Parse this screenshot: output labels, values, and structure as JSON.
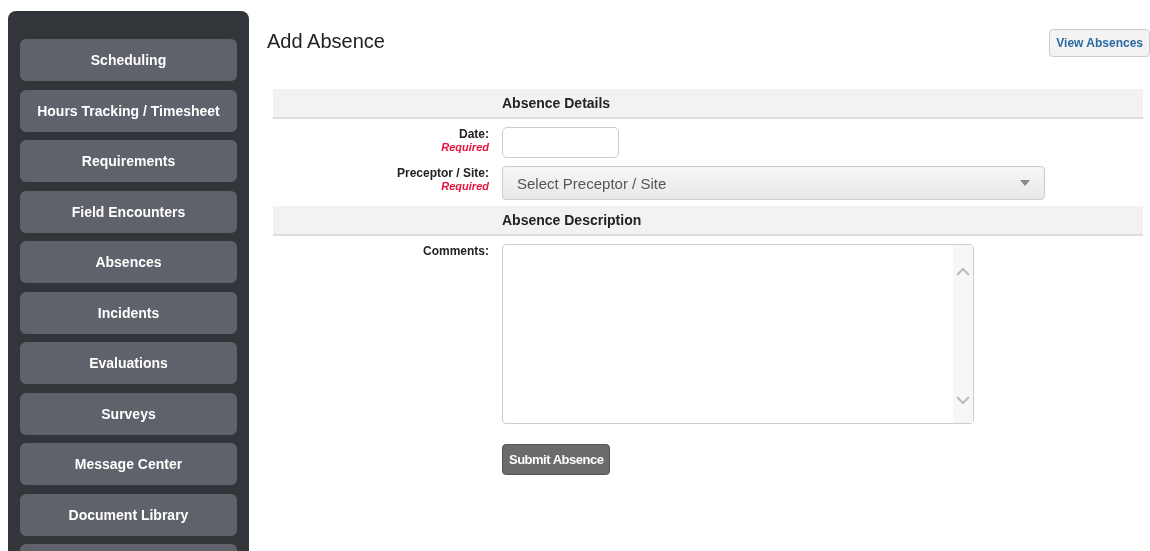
{
  "sidebar": {
    "items": [
      {
        "label": "Scheduling"
      },
      {
        "label": "Hours Tracking / Timesheet"
      },
      {
        "label": "Requirements"
      },
      {
        "label": "Field Encounters"
      },
      {
        "label": "Absences"
      },
      {
        "label": "Incidents"
      },
      {
        "label": "Evaluations"
      },
      {
        "label": "Surveys"
      },
      {
        "label": "Message Center"
      },
      {
        "label": "Document Library"
      }
    ]
  },
  "page": {
    "title": "Add Absence",
    "view_button": "View Absences"
  },
  "sections": [
    {
      "title": "Absence Details",
      "fields": [
        {
          "kind": "text",
          "label": "Date:",
          "required_note": "Required"
        },
        {
          "kind": "select",
          "label": "Preceptor / Site:",
          "required_note": "Required",
          "placeholder": "Select Preceptor / Site"
        }
      ]
    },
    {
      "title": "Absence Description",
      "fields": [
        {
          "kind": "textarea",
          "label": "Comments:"
        }
      ]
    }
  ],
  "submit_button": "Submit Absence"
}
